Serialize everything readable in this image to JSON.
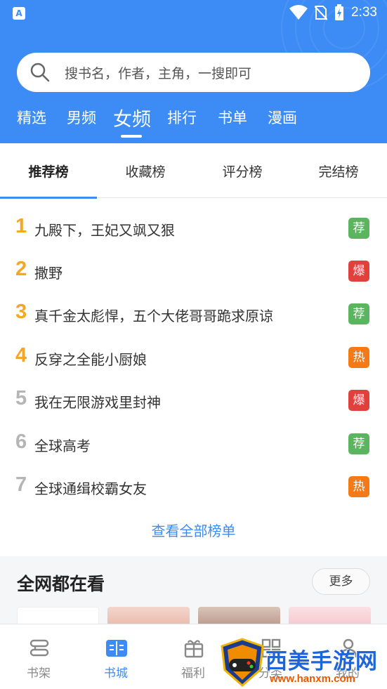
{
  "status_bar": {
    "time": "2:33",
    "app_icon": "A"
  },
  "search": {
    "placeholder": "搜书名，作者，主角，一搜即可"
  },
  "top_tabs": [
    {
      "label": "精选",
      "active": false
    },
    {
      "label": "男频",
      "active": false
    },
    {
      "label": "女频",
      "active": true
    },
    {
      "label": "排行",
      "active": false
    },
    {
      "label": "书单",
      "active": false
    },
    {
      "label": "漫画",
      "active": false
    }
  ],
  "rank_tabs": [
    {
      "label": "推荐榜",
      "active": true
    },
    {
      "label": "收藏榜",
      "active": false
    },
    {
      "label": "评分榜",
      "active": false
    },
    {
      "label": "完结榜",
      "active": false
    }
  ],
  "rank_list": [
    {
      "rank": "1",
      "title": "九殿下，王妃又飒又狠",
      "badge": "荐",
      "badge_color": "#5bb55f",
      "rank_color": "#f5a623"
    },
    {
      "rank": "2",
      "title": "撒野",
      "badge": "爆",
      "badge_color": "#e0413c",
      "rank_color": "#f5a623"
    },
    {
      "rank": "3",
      "title": "真千金太彪悍，五个大佬哥哥跪求原谅",
      "badge": "荐",
      "badge_color": "#5bb55f",
      "rank_color": "#f5a623"
    },
    {
      "rank": "4",
      "title": "反穿之全能小厨娘",
      "badge": "热",
      "badge_color": "#f47a17",
      "rank_color": "#f5a623"
    },
    {
      "rank": "5",
      "title": "我在无限游戏里封神",
      "badge": "爆",
      "badge_color": "#e0413c",
      "rank_color": "#b5b5b5"
    },
    {
      "rank": "6",
      "title": "全球高考",
      "badge": "荐",
      "badge_color": "#5bb55f",
      "rank_color": "#b5b5b5"
    },
    {
      "rank": "7",
      "title": "全球通缉校霸女友",
      "badge": "热",
      "badge_color": "#f47a17",
      "rank_color": "#b5b5b5"
    }
  ],
  "view_all_label": "查看全部榜单",
  "section": {
    "title": "全网都在看",
    "more_label": "更多"
  },
  "bottom_nav": [
    {
      "label": "书架",
      "icon": "bookshelf-icon",
      "active": false
    },
    {
      "label": "书城",
      "icon": "book-open-icon",
      "active": true
    },
    {
      "label": "福利",
      "icon": "gift-icon",
      "active": false
    },
    {
      "label": "分类",
      "icon": "grid-icon",
      "active": false
    },
    {
      "label": "我的",
      "icon": "user-icon",
      "active": false
    }
  ],
  "watermark": {
    "text": "西美手游网",
    "url": "www.hanxm.com"
  },
  "colors": {
    "accent": "#3d8cf5",
    "header_bg": "#3d8cf5"
  }
}
